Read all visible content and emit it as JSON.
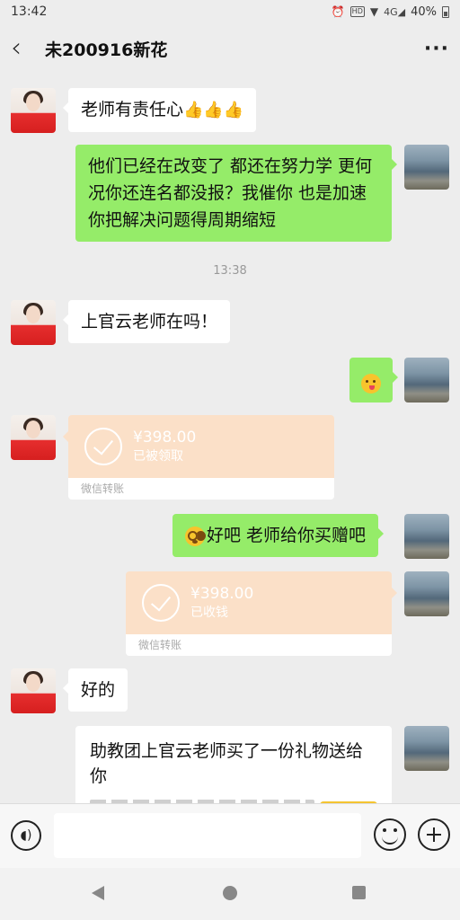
{
  "status_bar": {
    "time": "13:42",
    "network": "4G",
    "hd": "HD",
    "battery": "40%"
  },
  "header": {
    "title": "未200916新花",
    "back_icon": "chevron-left-icon",
    "more_icon": "more-dots-icon"
  },
  "messages": {
    "m1": {
      "text": "老师有责任心",
      "emoji": "👍👍👍"
    },
    "m2": {
      "text": "他们已经在改变了 都还在努力学 更何况你还连名都没报？我催你 也是加速你把解决问题得周期缩短"
    },
    "time1": "13:38",
    "m3": {
      "text": "上官云老师在吗！"
    },
    "t1": {
      "amount": "¥398.00",
      "status": "已被领取",
      "label": "微信转账"
    },
    "m5": {
      "text": "好吧 老师给你买赠吧"
    },
    "t2": {
      "amount": "¥398.00",
      "status": "已收钱",
      "label": "微信转账"
    },
    "m6": {
      "text": "好的"
    },
    "m7": {
      "text": "助教团上官云老师买了一份礼物送给你"
    }
  },
  "input": {
    "placeholder": ""
  },
  "colors": {
    "self_bubble": "#95ec69",
    "other_bubble": "#ffffff",
    "transfer": "#fbe0c8",
    "background": "#ededed"
  }
}
